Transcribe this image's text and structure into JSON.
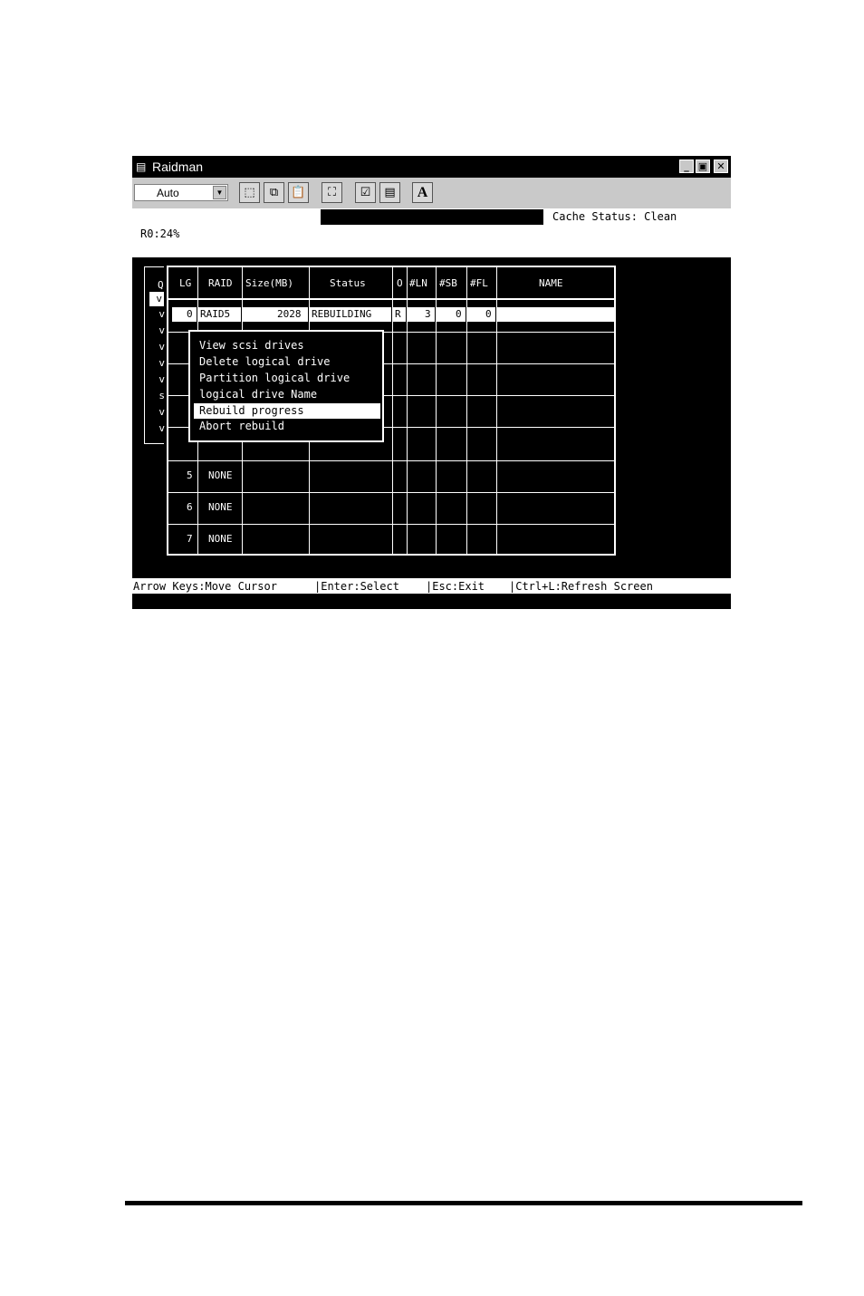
{
  "window": {
    "title": "Raidman",
    "controls": {
      "minimize": "_",
      "restore": "▣",
      "close": "✕"
    }
  },
  "toolbar": {
    "font_select": {
      "value": "Auto",
      "arrow": "▼"
    },
    "buttons": [
      {
        "name": "mark-icon",
        "glyph": "⬚"
      },
      {
        "name": "copy-icon",
        "glyph": "⧉"
      },
      {
        "name": "paste-icon",
        "glyph": "📋"
      },
      {
        "name": "fullscreen-icon",
        "glyph": "⛶"
      },
      {
        "name": "properties-icon",
        "glyph": "☑"
      },
      {
        "name": "background-icon",
        "glyph": "▤"
      },
      {
        "name": "font-icon",
        "glyph": "A"
      }
    ]
  },
  "header": {
    "cache_status": "Cache Status: Clean",
    "progress": "R0:24%"
  },
  "left_list": {
    "header": "Q",
    "selected": "v",
    "rows": [
      "v",
      "v",
      "v",
      "v",
      "v",
      "s",
      "v",
      "v"
    ]
  },
  "table": {
    "columns": [
      "LG",
      "RAID",
      "Size(MB)",
      "Status",
      "O",
      "#LN",
      "#SB",
      "#FL",
      "NAME"
    ],
    "selected_row": {
      "lg": "0",
      "raid": "RAID5",
      "size": "2028",
      "status": "REBUILDING",
      "o": "R",
      "ln": "3",
      "sb": "0",
      "fl": "0",
      "name": ""
    },
    "rows": [
      {
        "lg": "5",
        "raid": "NONE"
      },
      {
        "lg": "6",
        "raid": "NONE"
      },
      {
        "lg": "7",
        "raid": "NONE"
      }
    ]
  },
  "menu": {
    "items": [
      "View scsi drives",
      "Delete logical drive",
      "Partition logical drive",
      "logical drive Name",
      "Rebuild progress",
      "Abort rebuild"
    ],
    "highlighted_index": 4
  },
  "statusbar": {
    "move": "Arrow Keys:Move Cursor",
    "select": "|Enter:Select",
    "exit": "|Esc:Exit",
    "refresh": "|Ctrl+L:Refresh Screen"
  }
}
